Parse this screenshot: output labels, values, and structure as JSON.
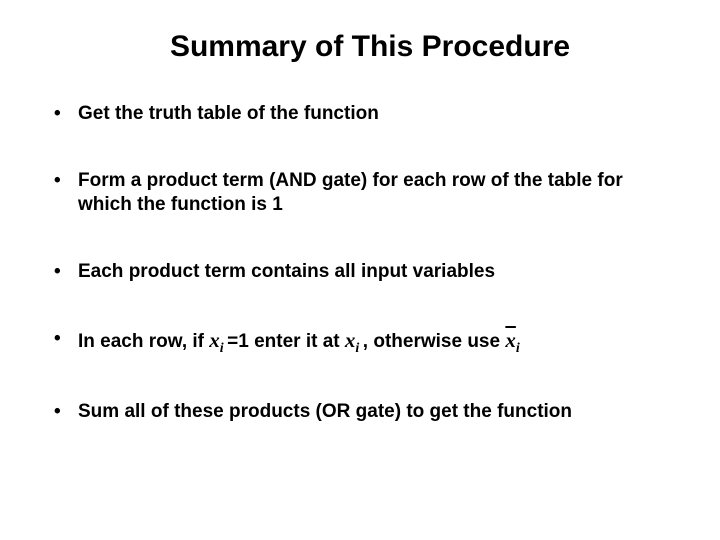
{
  "title": "Summary of This Procedure",
  "bullets": {
    "b1": "Get the truth table of the function",
    "b2": "Form a product term (AND gate) for each row of the table for which the function is 1",
    "b3": "Each product term contains all input variables",
    "b4_pre": "In each row, if ",
    "b4_var1": "x",
    "b4_sub1": "i ",
    "b4_mid1": "=1 enter it at ",
    "b4_var2": "x",
    "b4_sub2": "i ",
    "b4_mid2": ", otherwise use ",
    "b4_var3": "x",
    "b4_sub3": "i",
    "b5": "Sum all of these products (OR gate) to get the function"
  }
}
